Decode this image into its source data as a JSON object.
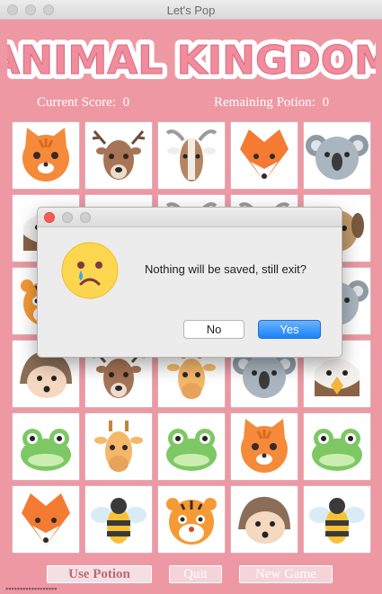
{
  "window": {
    "title": "Let's Pop"
  },
  "game": {
    "logo_text": "ANIMAL KINGDOM",
    "score_label": "Current Score:",
    "score_value": "0",
    "potion_label": "Remaining Potion:",
    "potion_value": "0",
    "grid": [
      [
        "cat",
        "deer",
        "goat",
        "fox",
        "koala"
      ],
      [
        "eagle",
        "raccoon",
        "goat",
        "goat",
        "dog"
      ],
      [
        "tiger",
        "deer",
        "fox",
        "frog",
        "koala"
      ],
      [
        "hedgehog",
        "deer",
        "giraffe",
        "koala",
        "eagle"
      ],
      [
        "frog",
        "giraffe",
        "frog",
        "cat",
        "frog"
      ],
      [
        "fox",
        "bee",
        "tiger",
        "hedgehog",
        "bee"
      ]
    ],
    "buttons": {
      "use_potion": "Use Potion",
      "quit": "Quit",
      "new_game": "New Game"
    },
    "footer_text": "▪▪▪▪▪▪▪▪▪▪▪▪▪▪▪▪▪▪"
  },
  "dialog": {
    "message": "Nothing will be saved, still exit?",
    "no_label": "No",
    "yes_label": "Yes",
    "icon": "sad-emoji-icon"
  },
  "colors": {
    "background": "#ee98a4",
    "logo_fill": "#f08c9d",
    "accent_blue": "#1a82fb"
  }
}
